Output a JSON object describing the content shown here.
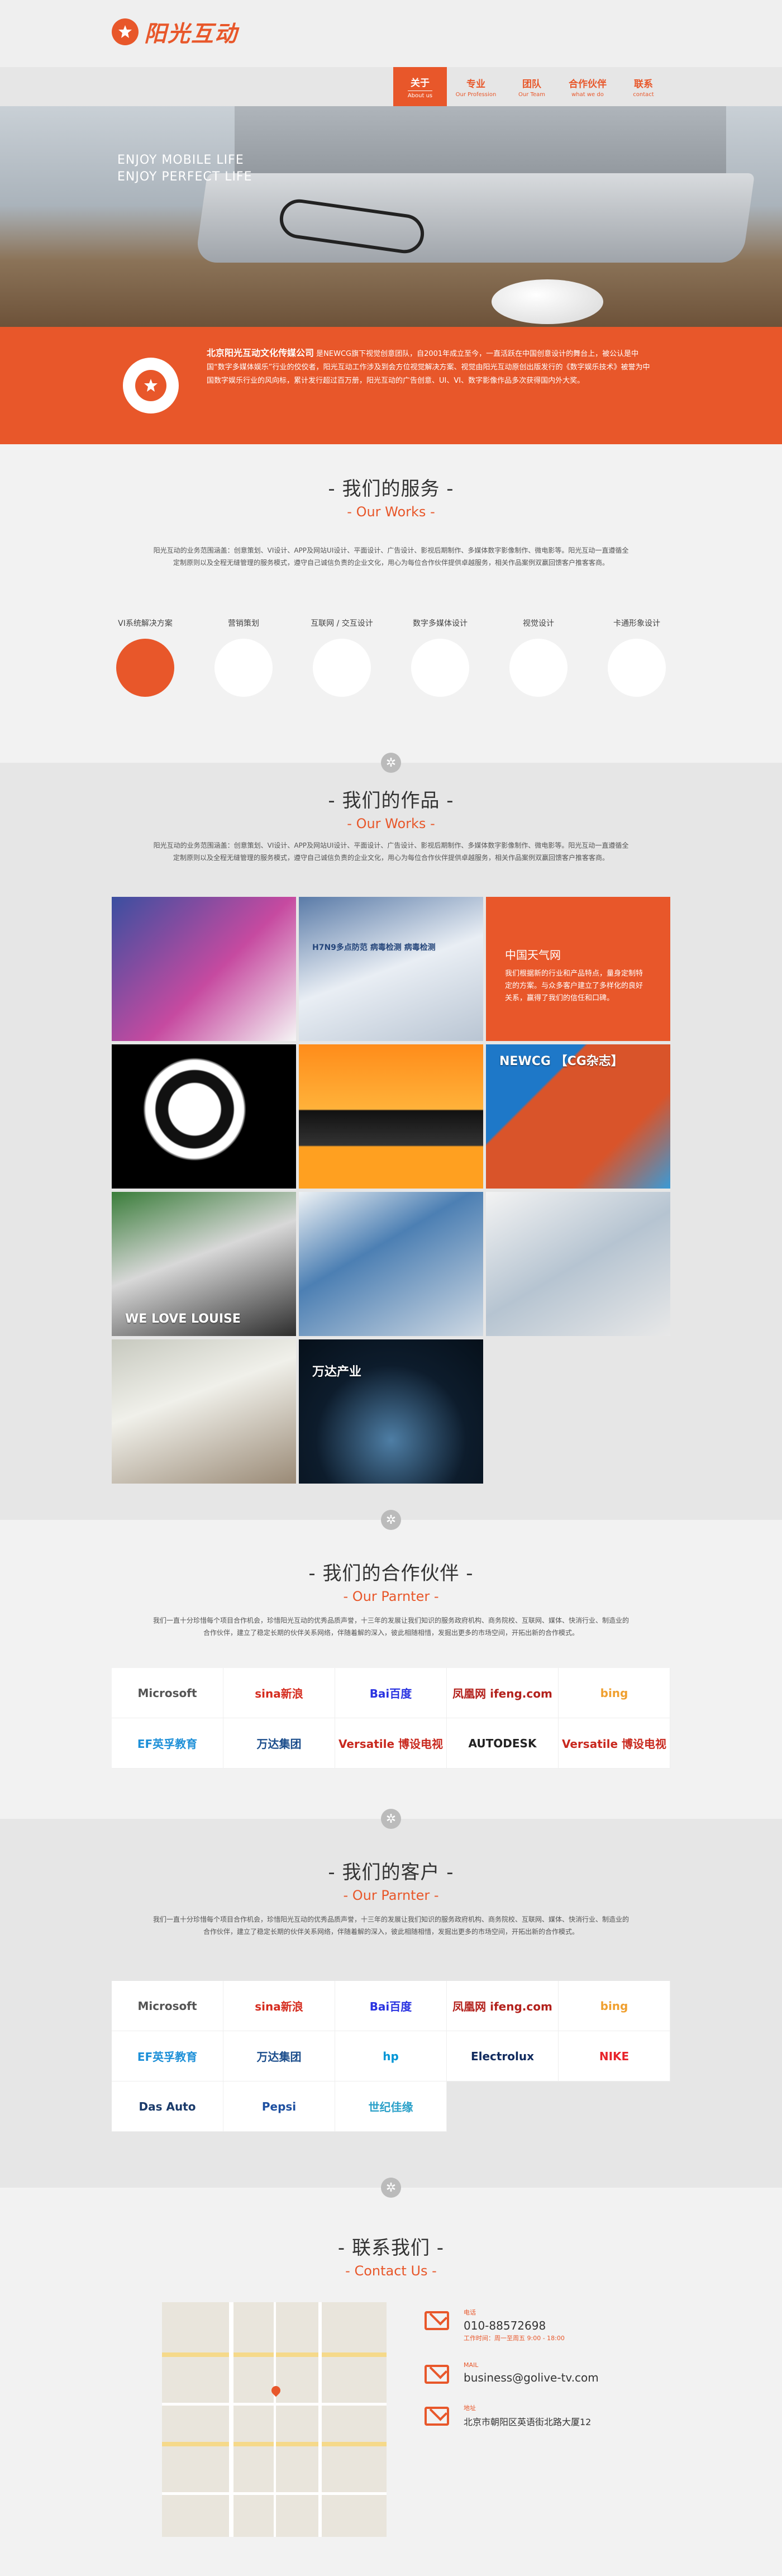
{
  "brand": {
    "name": "阳光互动"
  },
  "nav": [
    {
      "zh": "关于",
      "en": "About us",
      "active": true
    },
    {
      "zh": "专业",
      "en": "Our Profession"
    },
    {
      "zh": "团队",
      "en": "Our Team"
    },
    {
      "zh": "合作伙伴",
      "en": "what we do"
    },
    {
      "zh": "联系",
      "en": "contact"
    }
  ],
  "hero": {
    "line1": "ENJOY MOBILE LIFE",
    "line2": "ENJOY PERFECT LIFE"
  },
  "about": {
    "company": "北京阳光互动文化传媒公司",
    "text": "是NEWCG旗下视觉创意团队，自2001年成立至今，一直活跃在中国创意设计的舞台上，被公认是中国“数字多媒体娱乐”行业的佼佼者，阳光互动工作涉及到会方位视觉解决方案、视觉由阳光互动原创出版发行的《数字娱乐技术》被誉为中国数字娱乐行业的风向标，累计发行超过百万册，阳光互动的广告创意、UI、VI、数字影像作品多次获得国内外大奖。"
  },
  "services": {
    "title_zh": "我们的服务",
    "title_en": "Our Works",
    "desc": "阳光互动的业务范围涵盖：创意策划、VI设计、APP及网站UI设计、平面设计、广告设计、影视后期制作、多媒体数字影像制作、微电影等。阳光互动一直遵循全定制原则以及全程无缝管理的服务模式，遵守自己诚信负责的企业文化，用心为每位合作伙伴提供卓越服务，相关作品案例双赢回馈客户推客客商。",
    "items": [
      {
        "label": "VI系统解决方案",
        "active": true
      },
      {
        "label": "营销策划"
      },
      {
        "label": "互联网 / 交互设计"
      },
      {
        "label": "数字多媒体设计"
      },
      {
        "label": "视觉设计"
      },
      {
        "label": "卡通形象设计"
      }
    ]
  },
  "works": {
    "title_zh": "我们的作品",
    "title_en": "Our Works",
    "desc": "阳光互动的业务范围涵盖：创意策划、VI设计、APP及网站UI设计、平面设计、广告设计、影视后期制作、多媒体数字影像制作、微电影等。阳光互动一直遵循全定制原则以及全程无缝管理的服务模式，遵守自己诚信负责的企业文化，用心为每位合作伙伴提供卓越服务，相关作品案例双赢回馈客户推客客商。",
    "info": {
      "title": "中国天气网",
      "text": "我们根据新的行业和产品特点，量身定制特定的方案。与众多客户建立了多样化的良好关系，赢得了我们的信任和口碑。"
    },
    "tile_labels": {
      "t2": "H7N9多点防范 病毒检测 病毒检测",
      "t6": "NEWCG 【CG杂志】",
      "t7": "WE LOVE LOUISE",
      "t11": "万达产业"
    }
  },
  "partners": {
    "title_zh": "我们的合作伙伴",
    "title_en": "Our Parnter",
    "desc": "我们一直十分珍惜每个项目合作机会，珍惜阳光互动的优秀品质声誉，十三年的发展让我们知识的服务政府机构、商务院校、互联网、媒体、快消行业、制造业的合作伙伴，建立了稳定长期的伙伴关系网络，伴随着解的深入，彼此相随相惜，发掘出更多的市场空间，开拓出新的合作模式。",
    "logos": [
      "Microsoft",
      "sina新浪",
      "Bai百度",
      "凤凰网 ifeng.com",
      "bing",
      "EF英孚教育",
      "万达集团",
      "Versatile 博设电视",
      "AUTODESK",
      "Versatile 博设电视"
    ]
  },
  "clients": {
    "title_zh": "我们的客户",
    "title_en": "Our Parnter",
    "desc": "我们一直十分珍惜每个项目合作机会，珍惜阳光互动的优秀品质声誉，十三年的发展让我们知识的服务政府机构、商务院校、互联网、媒体、快消行业、制造业的合作伙伴，建立了稳定长期的伙伴关系网络，伴随着解的深入，彼此相随相惜，发掘出更多的市场空间，开拓出新的合作模式。",
    "logos": [
      "Microsoft",
      "sina新浪",
      "Bai百度",
      "凤凰网 ifeng.com",
      "bing",
      "EF英孚教育",
      "万达集团",
      "hp",
      "Electrolux",
      "NIKE",
      "Das Auto",
      "Pepsi",
      "世纪佳缘"
    ]
  },
  "contact": {
    "title_zh": "联系我们",
    "title_en": "Contact Us",
    "phone_label": "电话",
    "phone": "010-88572698",
    "phone_hours": "工作时间：周一至周五 9:00 - 18:00",
    "mail_label": "MAIL",
    "mail": "business@golive-tv.com",
    "addr_label": "地址",
    "addr": "北京市朝阳区英语街北路大厦12"
  },
  "colors": {
    "accent": "#e8572a",
    "bg_light": "#f2f2f2",
    "bg_gray": "#e6e6e6"
  }
}
